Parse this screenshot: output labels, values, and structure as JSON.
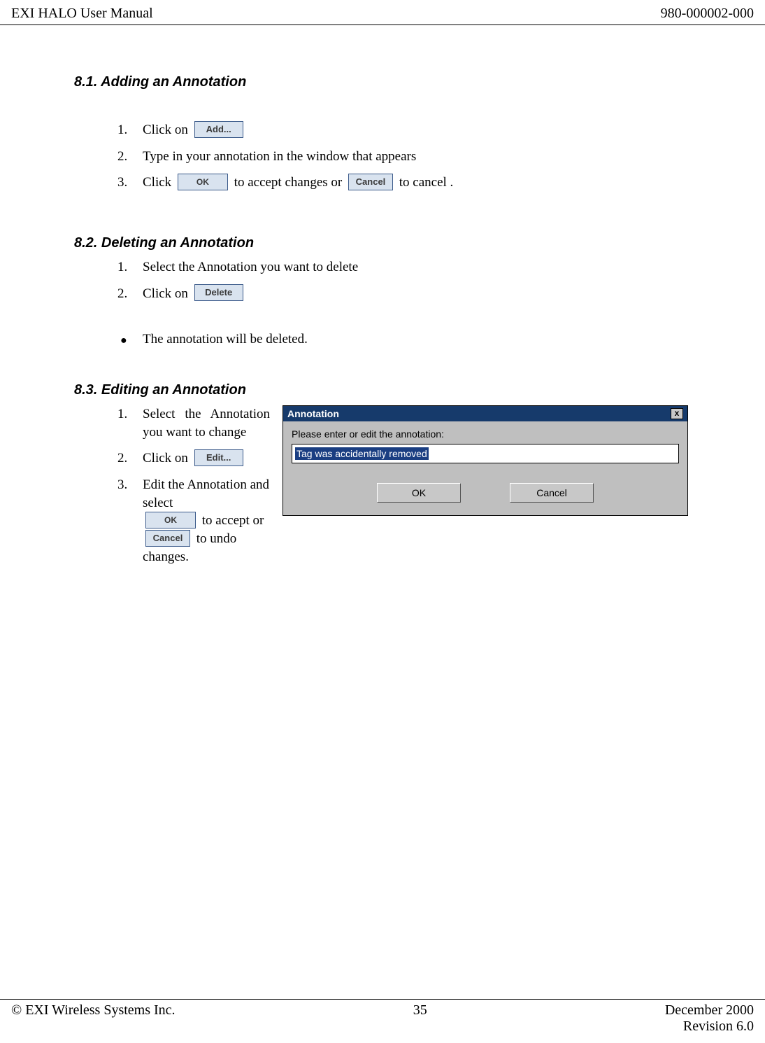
{
  "header": {
    "left": "EXI HALO User Manual",
    "right": "980-000002-000"
  },
  "s81": {
    "heading": "8.1.  Adding an Annotation",
    "step1_pre": "Click on",
    "step1_btn": "Add...",
    "step2": "Type in your annotation in the window that appears",
    "step3_a": "Click",
    "step3_ok": "OK",
    "step3_b": " to accept changes or ",
    "step3_cancel": "Cancel",
    "step3_c": " to cancel ."
  },
  "s82": {
    "heading": "8.2.  Deleting an Annotation",
    "step1": "Select the Annotation you want to delete",
    "step2_pre": "Click on",
    "step2_btn": "Delete",
    "bullet": "The annotation will be deleted."
  },
  "s83": {
    "heading": "8.3.  Editing an Annotation",
    "step1": "Select the Annotation you want to change",
    "step2_pre": "Click on",
    "step2_btn": "Edit...",
    "step3_a": "Edit the Annotation and select",
    "step3_ok": "OK",
    "step3_b": " to accept or ",
    "step3_cancel": "Cancel",
    "step3_c": " to undo changes."
  },
  "dialog": {
    "title": "Annotation",
    "label": "Please enter or edit the annotation:",
    "value": "Tag was accidentally removed",
    "ok": "OK",
    "cancel": "Cancel",
    "close": "x"
  },
  "footer": {
    "copyright": "© EXI Wireless Systems Inc.",
    "page": "35",
    "date": "December 2000",
    "revision": "Revision 6.0"
  }
}
